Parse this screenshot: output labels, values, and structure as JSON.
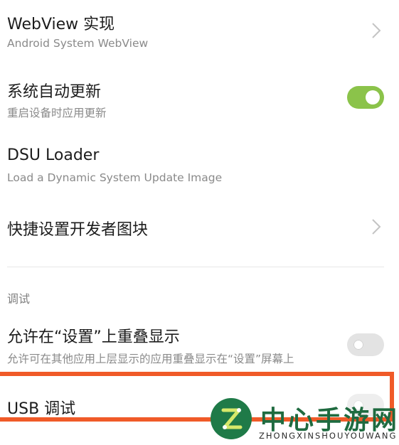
{
  "settings": [
    {
      "title": "WebView 实现",
      "subtitle": "Android System WebView",
      "control": "chevron"
    },
    {
      "title": "系统自动更新",
      "subtitle": "重启设备时应用更新",
      "control": "toggle-on"
    },
    {
      "title": "DSU Loader",
      "subtitle": "Load a Dynamic System Update Image",
      "control": "none"
    },
    {
      "title": "快捷设置开发者图块",
      "subtitle": "",
      "control": "chevron"
    }
  ],
  "debug_section": {
    "header": "调试",
    "items": [
      {
        "title": "允许在“设置”上重叠显示",
        "subtitle": "允许可在其他应用上层显示的应用重叠显示在“设置”屏幕上",
        "control": "toggle-off"
      },
      {
        "title": "USB 调试",
        "subtitle": "",
        "control": "toggle-off"
      }
    ]
  },
  "watermark": {
    "name": "中心手游网",
    "pinyin": "ZHONGXINSHOUYOUWANG"
  },
  "colors": {
    "toggle_on": "#8bc34a",
    "toggle_off": "#e3e3e3",
    "highlight_border": "#f05a28",
    "watermark_green": "#1f6b40"
  }
}
